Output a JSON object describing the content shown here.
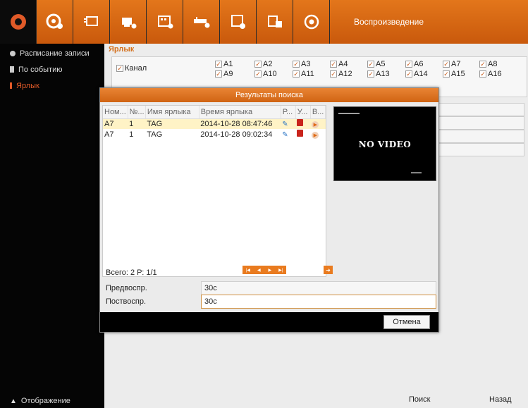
{
  "toolbar": {
    "title": "Воспроизведение",
    "icons": [
      "live-view-icon",
      "camera-settings-icon",
      "record-icon",
      "network-icon",
      "storage-icon",
      "devices-icon",
      "config-icon",
      "maintenance-icon",
      "power-icon"
    ]
  },
  "sidebar": {
    "items": [
      {
        "label": "Расписание записи"
      },
      {
        "label": "По событию"
      },
      {
        "label": "Ярлык"
      }
    ],
    "bottom_label": "Отображение"
  },
  "main": {
    "section_title": "Ярлык",
    "channel_label": "Канал",
    "channels": [
      "A1",
      "A2",
      "A3",
      "A4",
      "A5",
      "A6",
      "A7",
      "A8",
      "A9",
      "A10",
      "A11",
      "A12",
      "A13",
      "A14",
      "A15",
      "A16"
    ],
    "search_label": "Поиск",
    "back_label": "Назад"
  },
  "dialog": {
    "title": "Результаты поиска",
    "columns": [
      "Ном...",
      "№...",
      "Имя ярлыка",
      "Время ярлыка",
      "Р...",
      "У...",
      "В..."
    ],
    "rows": [
      {
        "cam": "A7",
        "num": "1",
        "name": "TAG",
        "time": "2014-10-28 08:47:46"
      },
      {
        "cam": "A7",
        "num": "1",
        "name": "TAG",
        "time": "2014-10-28 09:02:34"
      }
    ],
    "preview_text": "NO VIDEO",
    "total": "Всего: 2  Р: 1/1",
    "pre_label": "Предвоспр.",
    "pre_value": "30с",
    "post_label": "Поствоспр.",
    "post_value": "30с",
    "cancel_label": "Отмена"
  }
}
